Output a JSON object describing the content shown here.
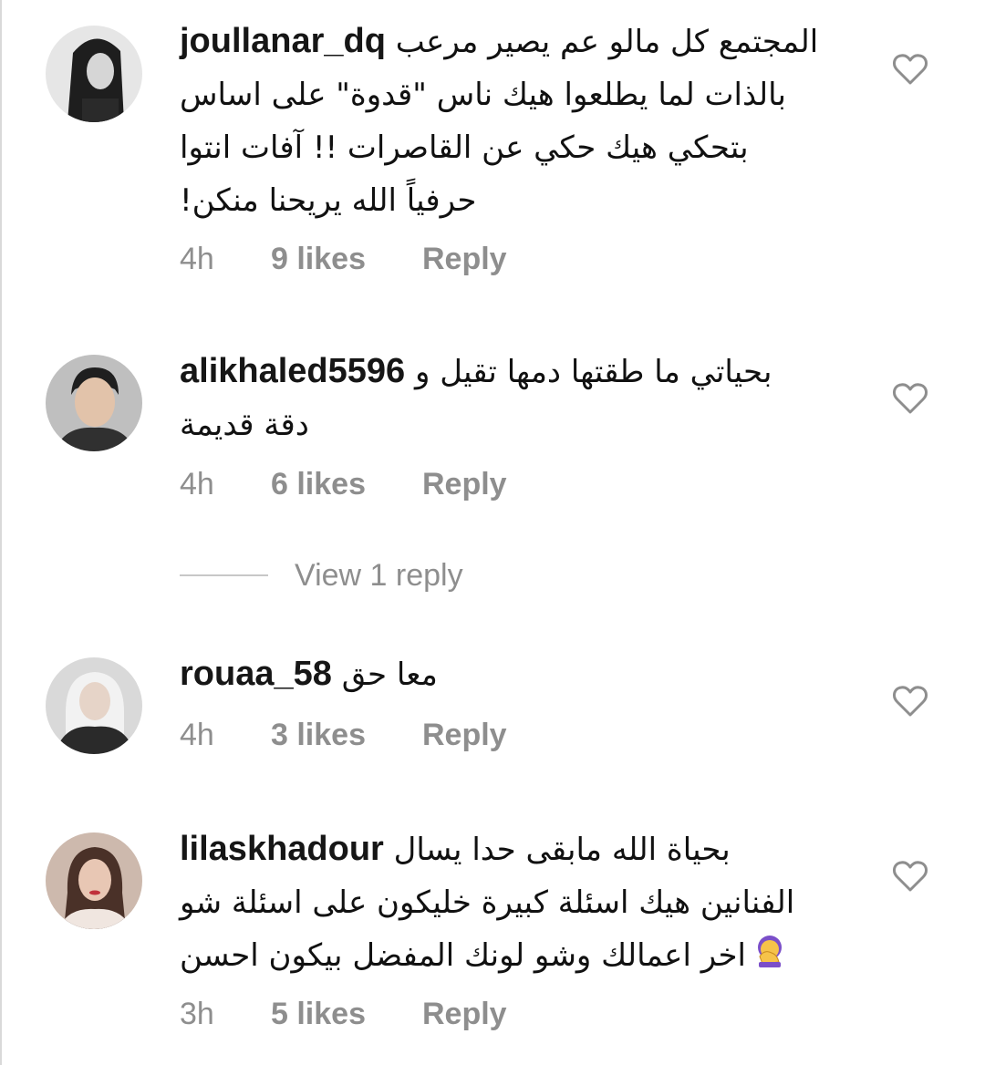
{
  "comments": [
    {
      "username": "joullanar_dq",
      "lines": [
        "المجتمع كل مالو عم يصير مرعب",
        "بالذات لما يطلعوا هيك ناس \"قدوة\" على اساس",
        "بتحكي هيك حكي عن القاصرات !! آفات انتوا",
        "حرفياً الله يريحنا منكن!"
      ],
      "time": "4h",
      "likes": "9 likes",
      "reply": "Reply",
      "like_icon": "heart-outline-icon"
    },
    {
      "username": "alikhaled5596",
      "lines": [
        "بحياتي ما طقتها دمها تقيل و",
        "دقة قديمة"
      ],
      "time": "4h",
      "likes": "6 likes",
      "reply": "Reply",
      "like_icon": "heart-outline-icon"
    },
    {
      "username": "rouaa_58",
      "lines": [
        "معا حق"
      ],
      "time": "4h",
      "likes": "3 likes",
      "reply": "Reply",
      "like_icon": "heart-outline-icon"
    },
    {
      "username": "lilaskhadour",
      "lines": [
        "بحياة الله مابقى حدا يسال",
        "الفنانين هيك اسئلة كبيرة  خليكون على اسئلة شو",
        "اخر اعمالك وشو لونك المفضل بيكون احسن"
      ],
      "emoji": "woman-facepalming-emoji",
      "time": "3h",
      "likes": "5 likes",
      "reply": "Reply",
      "like_icon": "heart-outline-icon"
    }
  ],
  "view_replies": "View 1 reply",
  "colors": {
    "meta": "#8e8e8e",
    "text": "#111111",
    "divider": "#c7c7c7"
  }
}
